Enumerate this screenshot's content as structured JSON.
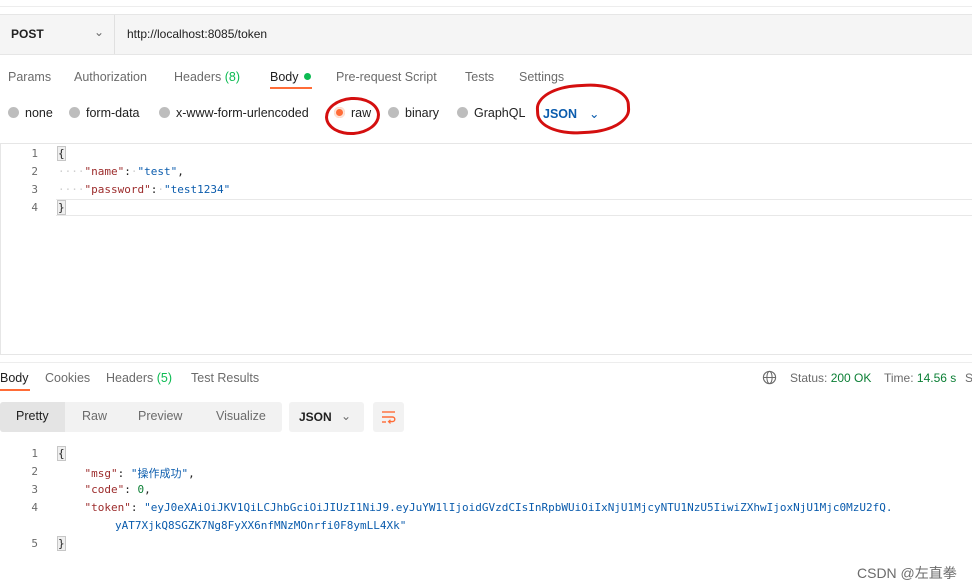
{
  "request": {
    "method": "POST",
    "url": "http://localhost:8085/token"
  },
  "req_tabs": [
    "Params",
    "Authorization",
    "Headers",
    "Body",
    "Pre-request Script",
    "Tests",
    "Settings"
  ],
  "req_headers_count": "(8)",
  "body_types": [
    "none",
    "form-data",
    "x-www-form-urlencoded",
    "raw",
    "binary",
    "GraphQL"
  ],
  "raw_format": "JSON",
  "request_body": {
    "line_numbers": [
      "1",
      "2",
      "3",
      "4"
    ],
    "open_brace": "{",
    "close_brace": "}",
    "name_key": "\"name\"",
    "name_value": "\"test\"",
    "password_key": "\"password\"",
    "password_value": "\"test1234\""
  },
  "res_tabs": [
    "Body",
    "Cookies",
    "Headers",
    "Test Results"
  ],
  "res_headers_count": "(5)",
  "status": {
    "status_label": "Status:",
    "status_value": "200 OK",
    "time_label": "Time:",
    "time_value": "14.56 s",
    "size_label": "S"
  },
  "view_tabs": [
    "Pretty",
    "Raw",
    "Preview",
    "Visualize"
  ],
  "response_format": "JSON",
  "response_body": {
    "line_numbers": [
      "1",
      "2",
      "3",
      "4",
      "5"
    ],
    "open_brace": "{",
    "close_brace": "}",
    "msg_key": "\"msg\"",
    "msg_value": "\"操作成功\"",
    "code_key": "\"code\"",
    "code_value": "0",
    "token_key": "\"token\"",
    "token_value_line1": "\"eyJ0eXAiOiJKV1QiLCJhbGciOiJIUzI1NiJ9.eyJuYW1lIjoidGVzdCIsInRpbWUiOiIxNjU1MjcyNTU1NzU5IiwiZXhwIjoxNjU1Mjc0MzU2fQ.",
    "token_value_line2": "yAT7XjkQ8SGZK7Ng8FyXX6nfMNzMOnrfi0F8ymLL4Xk\""
  },
  "watermark": "CSDN @左直拳",
  "colors": {
    "accent": "#ff6c37",
    "success": "#0cbb52",
    "annotation": "#d40f0f",
    "json_key": "#9c2b2b",
    "json_string": "#0b5cad"
  }
}
